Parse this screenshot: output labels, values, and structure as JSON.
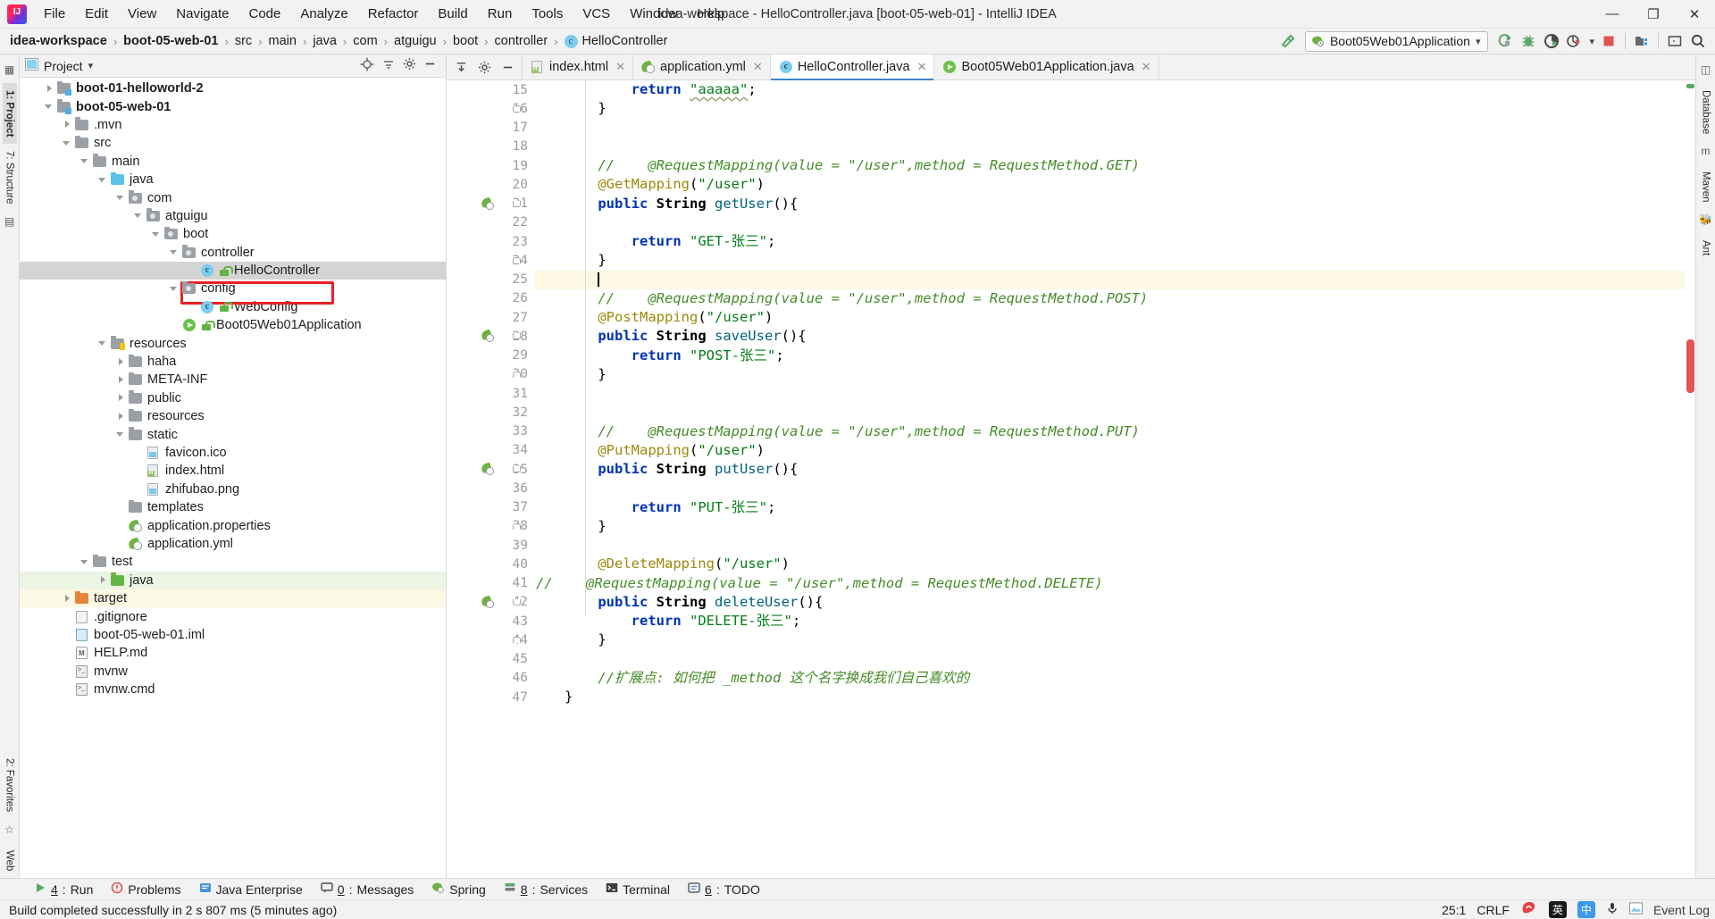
{
  "window": {
    "title": "idea-workspace - HelloController.java [boot-05-web-01] - IntelliJ IDEA",
    "minimize": "—",
    "maximize": "❐",
    "close": "✕",
    "logo_text": "IJ"
  },
  "menu": [
    {
      "label": "File"
    },
    {
      "label": "Edit"
    },
    {
      "label": "View"
    },
    {
      "label": "Navigate"
    },
    {
      "label": "Code"
    },
    {
      "label": "Analyze"
    },
    {
      "label": "Refactor"
    },
    {
      "label": "Build"
    },
    {
      "label": "Run"
    },
    {
      "label": "Tools"
    },
    {
      "label": "VCS"
    },
    {
      "label": "Window"
    },
    {
      "label": "Help"
    }
  ],
  "breadcrumb": {
    "items": [
      {
        "label": "idea-workspace",
        "bold": true
      },
      {
        "label": "boot-05-web-01",
        "bold": true
      },
      {
        "label": "src",
        "bold": false
      },
      {
        "label": "main",
        "bold": false
      },
      {
        "label": "java",
        "bold": false
      },
      {
        "label": "com",
        "bold": false
      },
      {
        "label": "atguigu",
        "bold": false
      },
      {
        "label": "boot",
        "bold": false
      },
      {
        "label": "controller",
        "bold": false
      },
      {
        "label": "HelloController",
        "bold": false,
        "icon": "class-icon"
      }
    ],
    "separator": "›"
  },
  "toolbar": {
    "run_config": "Boot05Web01Application",
    "dropdown_caret": "▾",
    "buttons": [
      {
        "name": "build-icon",
        "title": "Build"
      },
      {
        "name": "run-icon",
        "title": "Run"
      },
      {
        "name": "debug-icon",
        "title": "Debug"
      },
      {
        "name": "run-coverage-icon",
        "title": "Run with Coverage"
      },
      {
        "name": "profiler-icon",
        "title": "Profiler"
      },
      {
        "name": "stop-icon",
        "title": "Stop"
      },
      {
        "name": "project-structure-icon",
        "title": "Project Structure"
      },
      {
        "name": "terminal-icon",
        "title": "Terminal"
      },
      {
        "name": "search-everywhere-icon",
        "title": "Search Everywhere"
      }
    ]
  },
  "left_rail": {
    "tabs": [
      {
        "label": "1: Project",
        "active": true
      },
      {
        "label": "7: Structure",
        "active": false
      }
    ],
    "bottom_tabs": [
      {
        "label": "2: Favorites"
      },
      {
        "label": "Web"
      }
    ]
  },
  "right_rail": {
    "tabs": [
      {
        "label": "Database"
      },
      {
        "label": "Maven"
      },
      {
        "label": "Ant"
      }
    ]
  },
  "project_panel": {
    "title": "Project",
    "caret": "▾",
    "actions": [
      "locate-icon",
      "collapse-all-icon",
      "settings-icon",
      "hide-icon"
    ],
    "tree": [
      {
        "indent": 1,
        "arrow": "right",
        "icon": "module-folder",
        "label": "boot-01-helloworld-2",
        "bold": true
      },
      {
        "indent": 1,
        "arrow": "down",
        "icon": "module-folder",
        "label": "boot-05-web-01",
        "bold": true
      },
      {
        "indent": 2,
        "arrow": "right",
        "icon": "plain-folder",
        "label": ".mvn"
      },
      {
        "indent": 2,
        "arrow": "down",
        "icon": "plain-folder",
        "label": "src"
      },
      {
        "indent": 3,
        "arrow": "down",
        "icon": "plain-folder",
        "label": "main"
      },
      {
        "indent": 4,
        "arrow": "down",
        "icon": "source-folder",
        "label": "java"
      },
      {
        "indent": 5,
        "arrow": "down",
        "icon": "package-folder",
        "label": "com"
      },
      {
        "indent": 6,
        "arrow": "down",
        "icon": "package-folder",
        "label": "atguigu"
      },
      {
        "indent": 7,
        "arrow": "down",
        "icon": "package-folder",
        "label": "boot"
      },
      {
        "indent": 8,
        "arrow": "down",
        "icon": "package-folder",
        "label": "controller"
      },
      {
        "indent": 9,
        "arrow": "none",
        "icon": "class-icon",
        "lock": true,
        "label": "HelloController",
        "selected": true
      },
      {
        "indent": 8,
        "arrow": "down",
        "icon": "package-folder",
        "label": "config"
      },
      {
        "indent": 9,
        "arrow": "none",
        "icon": "class-icon",
        "lock": true,
        "label": "WebConfig"
      },
      {
        "indent": 8,
        "arrow": "none",
        "icon": "runnable-class-icon",
        "lock": true,
        "label": "Boot05Web01Application"
      },
      {
        "indent": 4,
        "arrow": "down",
        "icon": "resource-folder",
        "label": "resources"
      },
      {
        "indent": 5,
        "arrow": "right",
        "icon": "plain-folder",
        "label": "haha"
      },
      {
        "indent": 5,
        "arrow": "right",
        "icon": "plain-folder",
        "label": "META-INF"
      },
      {
        "indent": 5,
        "arrow": "right",
        "icon": "plain-folder",
        "label": "public"
      },
      {
        "indent": 5,
        "arrow": "right",
        "icon": "plain-folder",
        "label": "resources"
      },
      {
        "indent": 5,
        "arrow": "down",
        "icon": "plain-folder",
        "label": "static"
      },
      {
        "indent": 6,
        "arrow": "none",
        "icon": "image-file",
        "label": "favicon.ico"
      },
      {
        "indent": 6,
        "arrow": "none",
        "icon": "html-file",
        "label": "index.html"
      },
      {
        "indent": 6,
        "arrow": "none",
        "icon": "image-file",
        "label": "zhifubao.png"
      },
      {
        "indent": 5,
        "arrow": "none",
        "icon": "plain-folder",
        "label": "templates"
      },
      {
        "indent": 5,
        "arrow": "none",
        "icon": "spring-file",
        "label": "application.properties"
      },
      {
        "indent": 5,
        "arrow": "none",
        "icon": "spring-file",
        "label": "application.yml"
      },
      {
        "indent": 3,
        "arrow": "down",
        "icon": "plain-folder",
        "label": "test"
      },
      {
        "indent": 4,
        "arrow": "right",
        "icon": "test-source-folder",
        "label": "java",
        "rowbg": "green"
      },
      {
        "indent": 2,
        "arrow": "right",
        "icon": "target-folder",
        "label": "target",
        "rowbg": "yellow"
      },
      {
        "indent": 2,
        "arrow": "none",
        "icon": "git-file",
        "label": ".gitignore"
      },
      {
        "indent": 2,
        "arrow": "none",
        "icon": "iml-file",
        "label": "boot-05-web-01.iml"
      },
      {
        "indent": 2,
        "arrow": "none",
        "icon": "md-file",
        "label": "HELP.md"
      },
      {
        "indent": 2,
        "arrow": "none",
        "icon": "sh-file",
        "label": "mvnw"
      },
      {
        "indent": 2,
        "arrow": "none",
        "icon": "sh-file",
        "label": "mvnw.cmd"
      }
    ]
  },
  "editor": {
    "tabs": [
      {
        "label": "index.html",
        "icon": "html-file",
        "active": false
      },
      {
        "label": "application.yml",
        "icon": "spring-file",
        "active": false
      },
      {
        "label": "HelloController.java",
        "icon": "class-icon",
        "active": true
      },
      {
        "label": "Boot05Web01Application.java",
        "icon": "runnable-class-icon",
        "active": false
      }
    ],
    "close_glyph": "✕",
    "tab_tools": [
      "expand-icon",
      "settings-icon",
      "hide-icon"
    ],
    "first_line": 15,
    "caret_line": 25,
    "lines": [
      {
        "n": 15,
        "indent": 2,
        "tokens": [
          {
            "t": "return ",
            "c": "kw"
          },
          {
            "t": "\"aaaaa\"",
            "c": "str wavy"
          },
          {
            "t": ";",
            "c": ""
          }
        ]
      },
      {
        "n": 16,
        "indent": 1,
        "fold": "end",
        "tokens": [
          {
            "t": "}",
            "c": ""
          }
        ]
      },
      {
        "n": 17,
        "indent": 0,
        "tokens": []
      },
      {
        "n": 18,
        "indent": 0,
        "tokens": []
      },
      {
        "n": 19,
        "indent": 1,
        "tokens": [
          {
            "t": "//    @RequestMapping(value = \"/user\",method = RequestMethod.GET)",
            "c": "cmt"
          }
        ]
      },
      {
        "n": 20,
        "indent": 1,
        "tokens": [
          {
            "t": "@GetMapping",
            "c": "ann"
          },
          {
            "t": "(",
            "c": ""
          },
          {
            "t": "\"/user\"",
            "c": "str"
          },
          {
            "t": ")",
            "c": ""
          }
        ]
      },
      {
        "n": 21,
        "indent": 1,
        "gutter": "spring",
        "fold": "start",
        "tokens": [
          {
            "t": "public ",
            "c": "kw"
          },
          {
            "t": "String ",
            "c": "typ"
          },
          {
            "t": "getUser",
            "c": "mth"
          },
          {
            "t": "(){",
            "c": ""
          }
        ]
      },
      {
        "n": 22,
        "indent": 0,
        "tokens": []
      },
      {
        "n": 23,
        "indent": 2,
        "tokens": [
          {
            "t": "return ",
            "c": "kw"
          },
          {
            "t": "\"GET-张三\"",
            "c": "str"
          },
          {
            "t": ";",
            "c": ""
          }
        ]
      },
      {
        "n": 24,
        "indent": 1,
        "fold": "end",
        "tokens": [
          {
            "t": "}",
            "c": ""
          }
        ]
      },
      {
        "n": 25,
        "indent": 1,
        "caret": true,
        "tokens": []
      },
      {
        "n": 26,
        "indent": 1,
        "tokens": [
          {
            "t": "//    @RequestMapping(value = \"/user\",method = RequestMethod.POST)",
            "c": "cmt"
          }
        ]
      },
      {
        "n": 27,
        "indent": 1,
        "tokens": [
          {
            "t": "@PostMapping",
            "c": "ann"
          },
          {
            "t": "(",
            "c": ""
          },
          {
            "t": "\"/user\"",
            "c": "str"
          },
          {
            "t": ")",
            "c": ""
          }
        ]
      },
      {
        "n": 28,
        "indent": 1,
        "gutter": "spring",
        "fold": "start",
        "tokens": [
          {
            "t": "public ",
            "c": "kw"
          },
          {
            "t": "String ",
            "c": "typ"
          },
          {
            "t": "saveUser",
            "c": "mth"
          },
          {
            "t": "(){",
            "c": ""
          }
        ]
      },
      {
        "n": 29,
        "indent": 2,
        "tokens": [
          {
            "t": "return ",
            "c": "kw"
          },
          {
            "t": "\"POST-张三\"",
            "c": "str"
          },
          {
            "t": ";",
            "c": ""
          }
        ]
      },
      {
        "n": 30,
        "indent": 1,
        "fold": "end",
        "tokens": [
          {
            "t": "}",
            "c": ""
          }
        ]
      },
      {
        "n": 31,
        "indent": 0,
        "tokens": []
      },
      {
        "n": 32,
        "indent": 0,
        "tokens": []
      },
      {
        "n": 33,
        "indent": 1,
        "tokens": [
          {
            "t": "//    @RequestMapping(value = \"/user\",method = RequestMethod.PUT)",
            "c": "cmt"
          }
        ]
      },
      {
        "n": 34,
        "indent": 1,
        "tokens": [
          {
            "t": "@PutMapping",
            "c": "ann"
          },
          {
            "t": "(",
            "c": ""
          },
          {
            "t": "\"/user\"",
            "c": "str"
          },
          {
            "t": ")",
            "c": ""
          }
        ]
      },
      {
        "n": 35,
        "indent": 1,
        "gutter": "spring",
        "fold": "start",
        "tokens": [
          {
            "t": "public ",
            "c": "kw"
          },
          {
            "t": "String ",
            "c": "typ"
          },
          {
            "t": "putUser",
            "c": "mth"
          },
          {
            "t": "(){",
            "c": ""
          }
        ]
      },
      {
        "n": 36,
        "indent": 0,
        "tokens": []
      },
      {
        "n": 37,
        "indent": 2,
        "tokens": [
          {
            "t": "return ",
            "c": "kw"
          },
          {
            "t": "\"PUT-张三\"",
            "c": "str"
          },
          {
            "t": ";",
            "c": ""
          }
        ]
      },
      {
        "n": 38,
        "indent": 1,
        "fold": "end",
        "tokens": [
          {
            "t": "}",
            "c": ""
          }
        ]
      },
      {
        "n": 39,
        "indent": 0,
        "tokens": []
      },
      {
        "n": 40,
        "indent": 1,
        "tokens": [
          {
            "t": "@DeleteMapping",
            "c": "ann"
          },
          {
            "t": "(",
            "c": ""
          },
          {
            "t": "\"/user\"",
            "c": "str"
          },
          {
            "t": ")",
            "c": ""
          }
        ]
      },
      {
        "n": 41,
        "indent": 0,
        "nopad": true,
        "tokens": [
          {
            "t": "//    @RequestMapping(value = \"/user\",method = RequestMethod.DELETE)",
            "c": "cmt"
          }
        ]
      },
      {
        "n": 42,
        "indent": 1,
        "gutter": "spring",
        "fold": "start",
        "tokens": [
          {
            "t": "public ",
            "c": "kw"
          },
          {
            "t": "String ",
            "c": "typ"
          },
          {
            "t": "deleteUser",
            "c": "mth"
          },
          {
            "t": "(){",
            "c": ""
          }
        ]
      },
      {
        "n": 43,
        "indent": 2,
        "tokens": [
          {
            "t": "return ",
            "c": "kw"
          },
          {
            "t": "\"DELETE-张三\"",
            "c": "str"
          },
          {
            "t": ";",
            "c": ""
          }
        ]
      },
      {
        "n": 44,
        "indent": 1,
        "fold": "end",
        "tokens": [
          {
            "t": "}",
            "c": ""
          }
        ]
      },
      {
        "n": 45,
        "indent": 0,
        "tokens": []
      },
      {
        "n": 46,
        "indent": 1,
        "tokens": [
          {
            "t": "//扩展点: 如何把 _method 这个名字换成我们自己喜欢的",
            "c": "cmt"
          }
        ]
      },
      {
        "n": 47,
        "indent": 0,
        "tokens": [
          {
            "t": "}",
            "c": ""
          }
        ]
      }
    ]
  },
  "bottom_tools": [
    {
      "num": "4",
      "label": "Run",
      "icon": "run-icon"
    },
    {
      "num": "",
      "label": "Problems",
      "icon": "problems-icon"
    },
    {
      "num": "",
      "label": "Java Enterprise",
      "icon": "java-ee-icon"
    },
    {
      "num": "0",
      "label": "Messages",
      "icon": "messages-icon"
    },
    {
      "num": "",
      "label": "Spring",
      "icon": "spring-icon"
    },
    {
      "num": "8",
      "label": "Services",
      "icon": "services-icon"
    },
    {
      "num": "",
      "label": "Terminal",
      "icon": "terminal-icon"
    },
    {
      "num": "6",
      "label": "TODO",
      "icon": "todo-icon"
    }
  ],
  "status_bar": {
    "message": "Build completed successfully in 2 s 807 ms (5 minutes ago)",
    "caret_position": "25:1",
    "line_separator": "CRLF",
    "ime_cn": "英",
    "ime_mode": "中",
    "event_log": "Event Log"
  }
}
